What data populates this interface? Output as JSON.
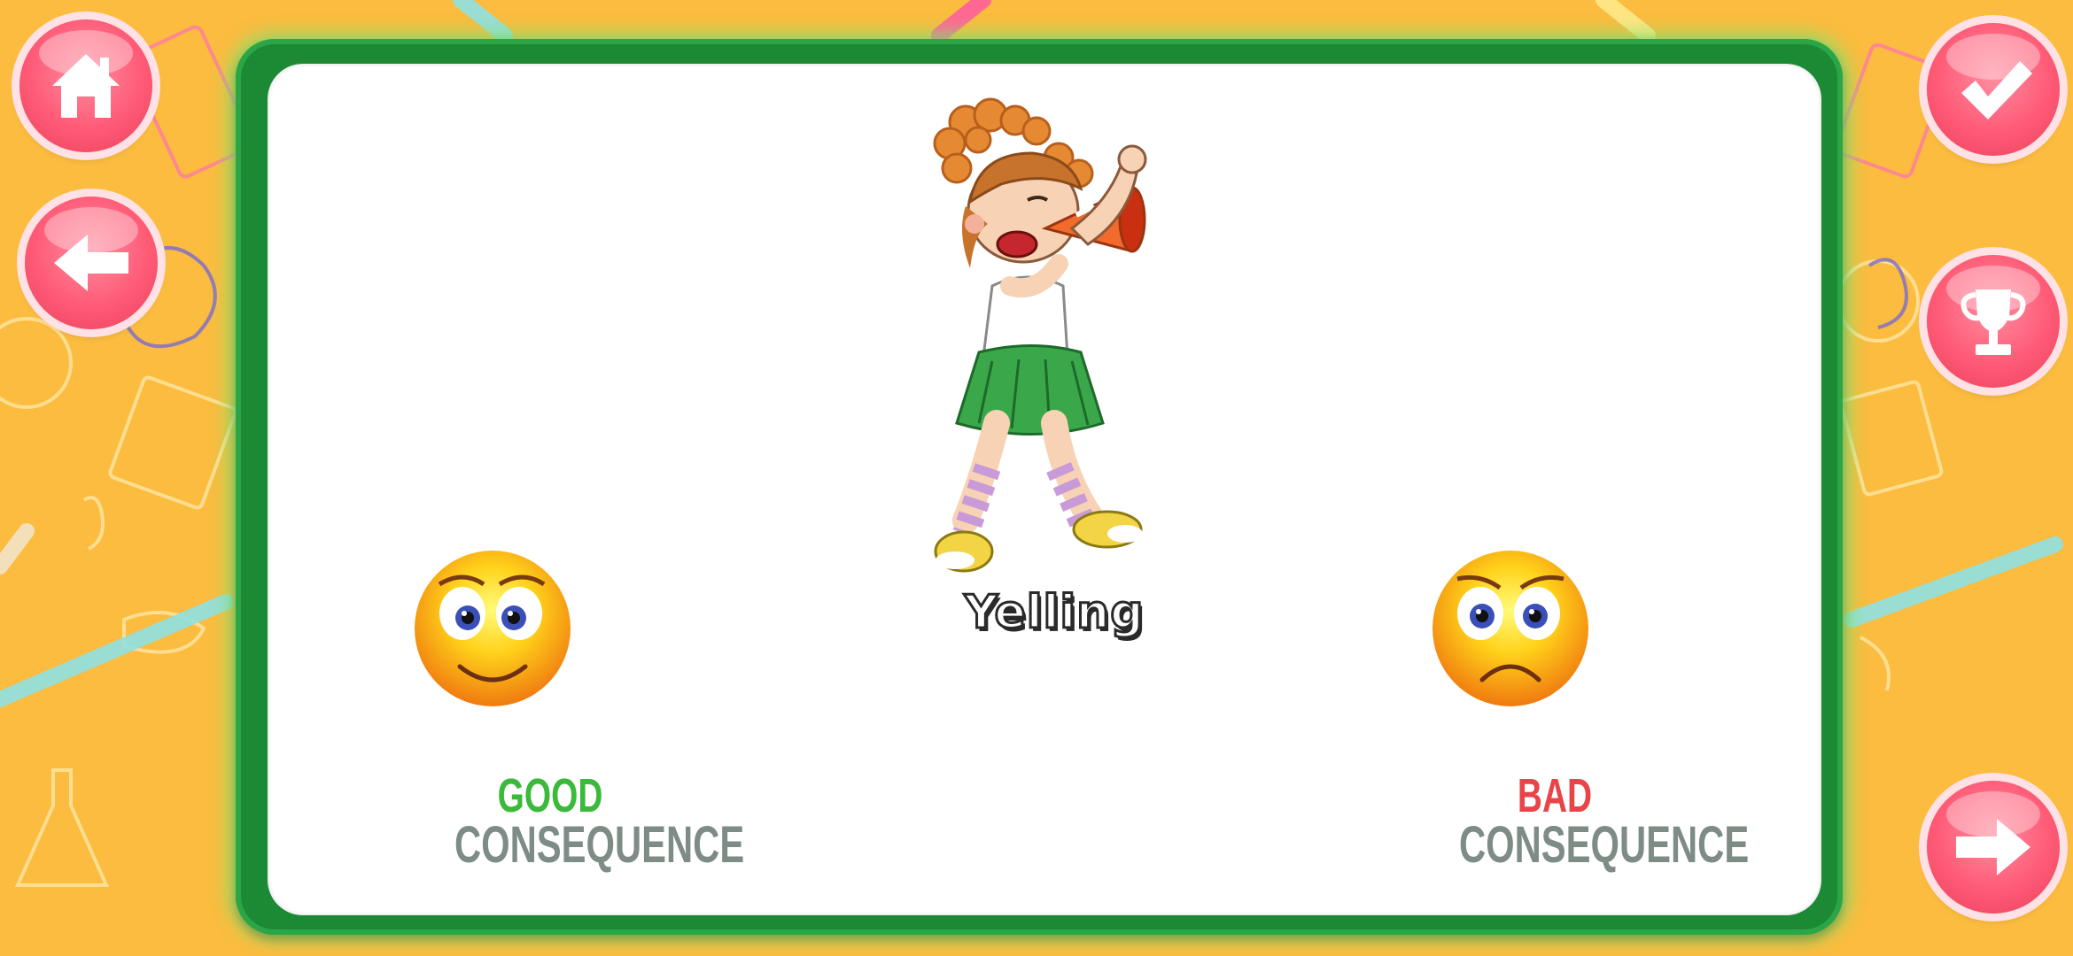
{
  "scene": {
    "caption": "Yelling",
    "good": {
      "label_top": "GOOD",
      "label_bottom": "CONSEQUENCE",
      "color": "#3ab93a",
      "emoji": "smiling-face-icon"
    },
    "bad": {
      "label_top": "BAD",
      "label_bottom": "CONSEQUENCE",
      "color": "#e84449",
      "emoji": "sad-face-icon"
    }
  },
  "buttons": {
    "home": "home-icon",
    "back": "arrow-left-icon",
    "done": "checkmark-icon",
    "trophy": "trophy-icon",
    "next": "arrow-right-icon"
  },
  "colors": {
    "background": "#fbbc3f",
    "board": "#1c8a35",
    "button": "#ff5a76"
  }
}
